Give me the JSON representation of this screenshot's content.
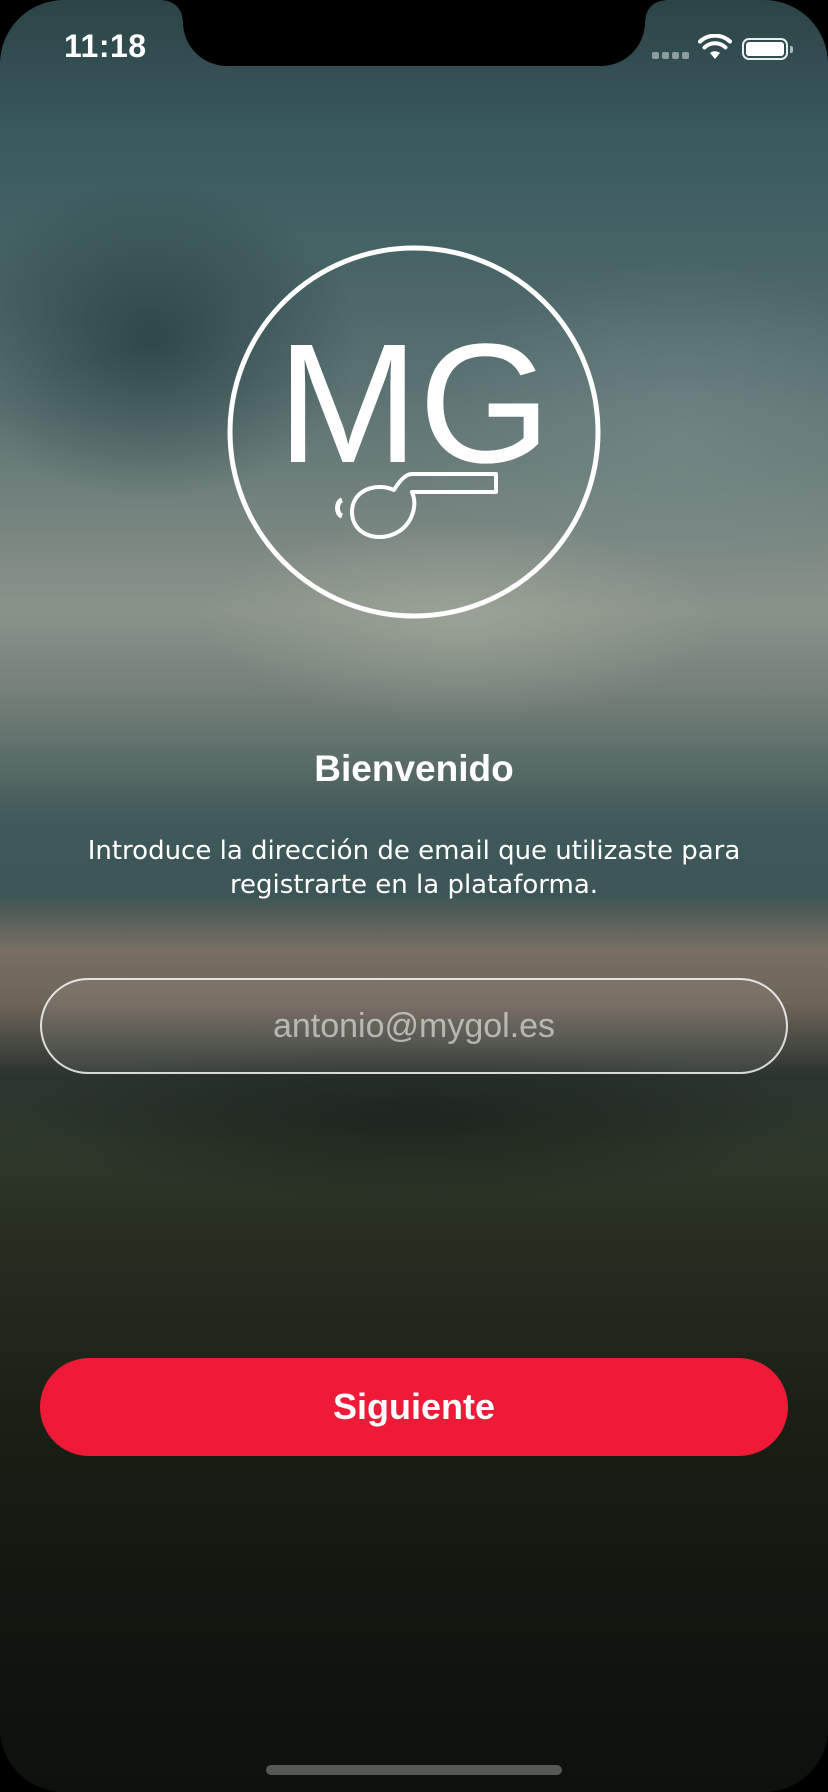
{
  "status_bar": {
    "time": "11:18",
    "icons": [
      "cellular-signal-icon",
      "wifi-icon",
      "battery-icon"
    ]
  },
  "logo": {
    "monogram": "MG",
    "icon": "whistle-icon"
  },
  "welcome": {
    "title": "Bienvenido",
    "subtitle": "Introduce la dirección de email que utilizaste para registrarte en la plataforma."
  },
  "email_input": {
    "value": "",
    "placeholder": "antonio@mygol.es"
  },
  "next_button": {
    "label": "Siguiente"
  },
  "colors": {
    "accent": "#ee1a38",
    "text": "#ffffff"
  }
}
